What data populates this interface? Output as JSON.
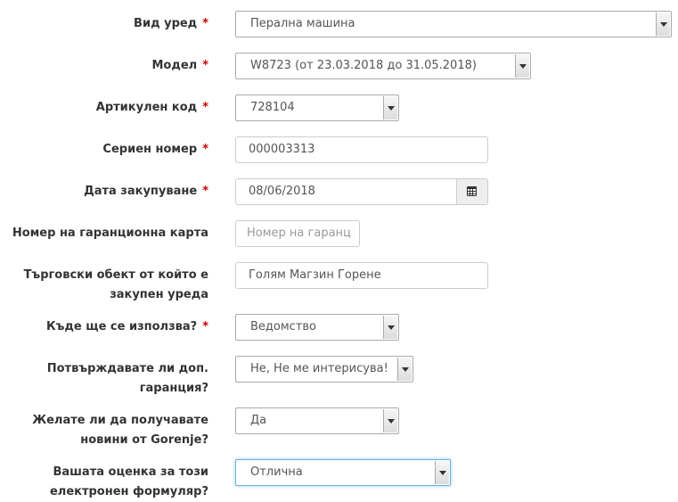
{
  "form": {
    "device_type": {
      "label": "Вид уред",
      "required_mark": "*",
      "value": "Перална машина"
    },
    "model": {
      "label": "Модел",
      "required_mark": "*",
      "value": "W8723 (от 23.03.2018 до 31.05.2018)"
    },
    "article_code": {
      "label": "Артикулен код",
      "required_mark": "*",
      "value": "728104"
    },
    "serial_number": {
      "label": "Сериен номер",
      "required_mark": "*",
      "value": "000003313"
    },
    "purchase_date": {
      "label": "Дата закупуване",
      "required_mark": "*",
      "value": "08/06/2018",
      "icon": "calendar-icon"
    },
    "warranty_card": {
      "label": "Номер на гаранционна карта",
      "placeholder": "Номер на гаранц"
    },
    "store": {
      "label_line1": "Търговски обект от който е",
      "label_line2": "закупен уреда",
      "value": "Голям Магзин Горене"
    },
    "usage": {
      "label": "Къде ще се използва?",
      "required_mark": "*",
      "value": "Ведомство"
    },
    "extra_warranty": {
      "label_line1": "Потвърждавате ли доп.",
      "label_line2": "гаранция?",
      "value": "Не, Не ме интерисува!"
    },
    "newsletter": {
      "label_line1": "Желате ли да получавате",
      "label_line2": "новини от Gorenje?",
      "value": "Да"
    },
    "rating": {
      "label_line1": "Вашата оценка за този",
      "label_line2": "електронен формуляр?",
      "value": "Отлична"
    }
  },
  "colors": {
    "required": "#cc0000",
    "focus_border": "#66afe9",
    "text": "#333333"
  }
}
